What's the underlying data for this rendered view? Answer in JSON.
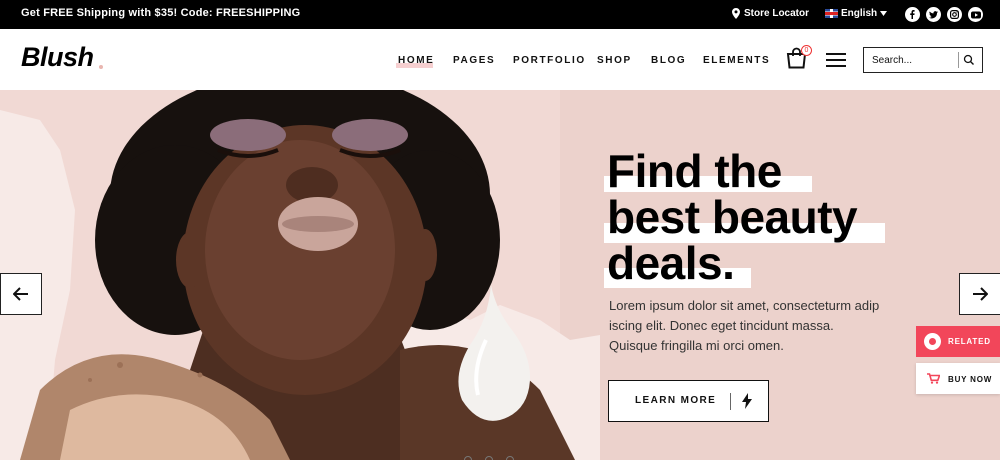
{
  "topbar": {
    "promo_prefix": "Get ",
    "promo_free": "FREE",
    "promo_middle": " Shipping with $35! Code: ",
    "promo_code": "FREESHIPPING",
    "store_locator": "Store Locator",
    "language": "English",
    "social_icons": [
      "facebook-icon",
      "twitter-icon",
      "instagram-icon",
      "youtube-icon"
    ]
  },
  "header": {
    "logo": "Blush",
    "nav": [
      "HOME",
      "PAGES",
      "PORTFOLIO",
      "SHOP",
      "BLOG",
      "ELEMENTS"
    ],
    "active_nav": "HOME",
    "cart_count": "0",
    "search_placeholder": "Search..."
  },
  "hero": {
    "title_lines": [
      "Find the",
      "best beauty",
      "deals."
    ],
    "text": "Lorem ipsum dolor sit amet, consecteturm adip iscing elit. Donec eget tincidunt massa. Quisque fringilla mi orci omen.",
    "button_label": "LEARN MORE",
    "slide_count": 3
  },
  "widgets": {
    "related": "RELATED",
    "buy_now": "BUY NOW"
  },
  "colors": {
    "hero_bg": "#f1d9d4",
    "accent_red": "#f2465a",
    "nav_highlight": "#f6cfd0"
  }
}
